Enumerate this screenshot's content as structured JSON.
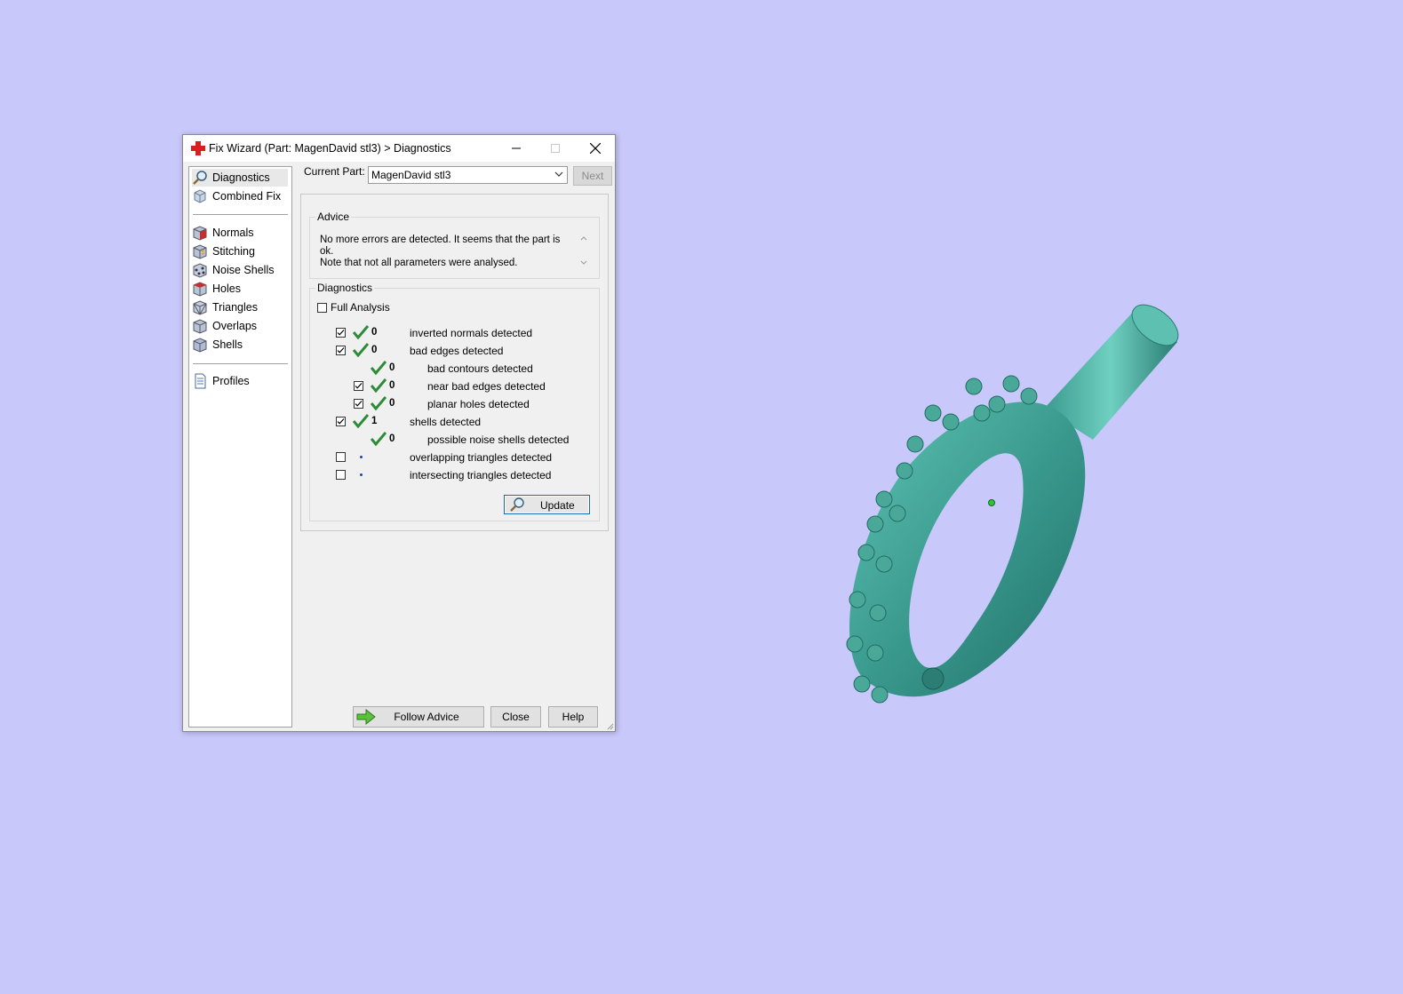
{
  "window": {
    "title": "Fix Wizard (Part: MagenDavid stl3) > Diagnostics",
    "app_icon": "red-cross-icon",
    "controls": [
      "minimize-icon",
      "maximize-icon",
      "close-icon"
    ]
  },
  "sidebar": {
    "top_items": [
      {
        "label": "Diagnostics",
        "icon": "magnifier-icon",
        "selected": true
      },
      {
        "label": "Combined Fix",
        "icon": "cube-icon",
        "selected": false
      }
    ],
    "tool_items": [
      {
        "label": "Normals",
        "icon": "normals-cube-icon"
      },
      {
        "label": "Stitching",
        "icon": "stitching-cube-icon"
      },
      {
        "label": "Noise Shells",
        "icon": "noise-shells-icon"
      },
      {
        "label": "Holes",
        "icon": "holes-cube-icon"
      },
      {
        "label": "Triangles",
        "icon": "triangles-cube-icon"
      },
      {
        "label": "Overlaps",
        "icon": "overlaps-cube-icon"
      },
      {
        "label": "Shells",
        "icon": "shells-cube-icon"
      }
    ],
    "bottom_items": [
      {
        "label": "Profiles",
        "icon": "document-icon"
      }
    ]
  },
  "header": {
    "current_part_label": "Current Part:",
    "current_part_value": "MagenDavid stl3",
    "next_label": "Next"
  },
  "advice": {
    "group_label": "Advice",
    "line1": "No more errors are detected. It seems that the part is ok.",
    "line2": "Note that not all parameters were analysed."
  },
  "diagnostics": {
    "group_label": "Diagnostics",
    "full_analysis_label": "Full Analysis",
    "full_analysis_checked": false,
    "rows": [
      {
        "checkbox": true,
        "checked": true,
        "status": "ok",
        "count": "0",
        "label": "inverted normals detected",
        "indent": 0
      },
      {
        "checkbox": true,
        "checked": true,
        "status": "ok",
        "count": "0",
        "label": "bad edges detected",
        "indent": 0
      },
      {
        "checkbox": false,
        "checked": false,
        "status": "ok",
        "count": "0",
        "label": "bad contours detected",
        "indent": 1
      },
      {
        "checkbox": true,
        "checked": true,
        "status": "ok",
        "count": "0",
        "label": "near bad edges detected",
        "indent": 1
      },
      {
        "checkbox": true,
        "checked": true,
        "status": "ok",
        "count": "0",
        "label": "planar holes detected",
        "indent": 1
      },
      {
        "checkbox": true,
        "checked": true,
        "status": "ok",
        "count": "1",
        "label": "shells detected",
        "indent": 0
      },
      {
        "checkbox": false,
        "checked": false,
        "status": "ok",
        "count": "0",
        "label": "possible noise shells detected",
        "indent": 1
      },
      {
        "checkbox": true,
        "checked": false,
        "status": "pending",
        "count": "",
        "label": "overlapping triangles detected",
        "indent": 0
      },
      {
        "checkbox": true,
        "checked": false,
        "status": "pending",
        "count": "",
        "label": "intersecting triangles detected",
        "indent": 0
      }
    ],
    "update_label": "Update"
  },
  "footer": {
    "follow_advice_label": "Follow Advice",
    "close_label": "Close",
    "help_label": "Help"
  },
  "colors": {
    "desktop_bg": "#c8c8fa",
    "check_green": "#2e8b3a",
    "model_teal": "#3a9a8e"
  }
}
